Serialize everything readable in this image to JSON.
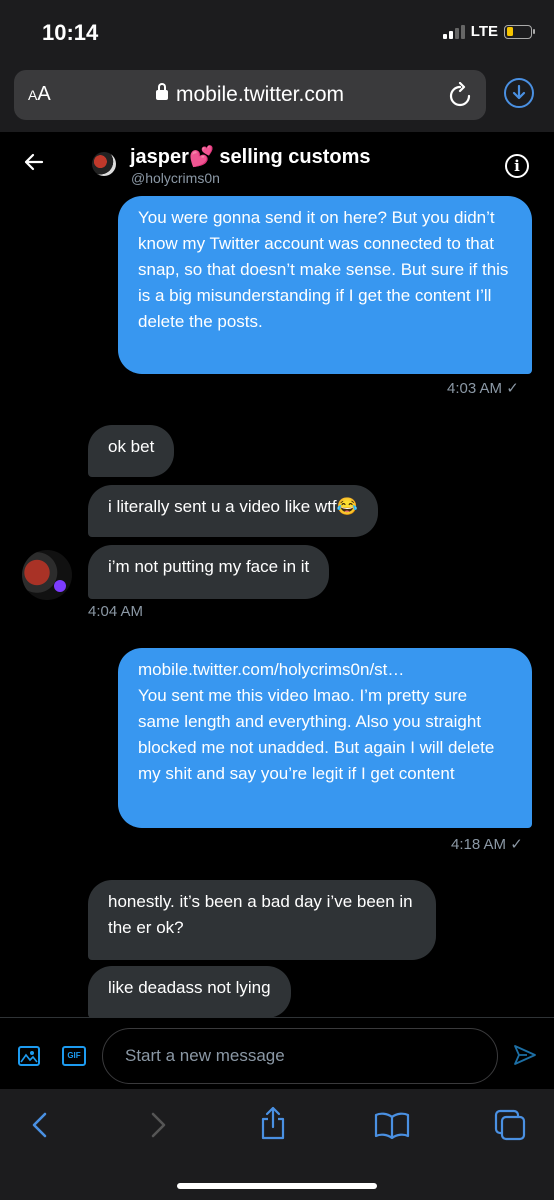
{
  "status_bar": {
    "time": "10:14",
    "network": "LTE"
  },
  "browser": {
    "aa_label": "AA",
    "url": "mobile.twitter.com"
  },
  "header": {
    "name_part1": "jasper",
    "heart": "💕",
    "name_part2": " selling customs",
    "handle": "@holycrims0n"
  },
  "messages": [
    {
      "type": "sent",
      "text": "You were gonna send it on here? But you didn’t know my Twitter account was connected to that snap, so that doesn’t make sense.  But sure if this is a big misunderstanding if I get the content I’ll delete the posts.",
      "time": "4:03 AM ✓"
    },
    {
      "type": "recv",
      "text": "ok bet"
    },
    {
      "type": "recv",
      "text": "i literally sent u a video like wtf😂"
    },
    {
      "type": "recv",
      "text": "i’m not putting my face in it",
      "time": "4:04 AM"
    },
    {
      "type": "sent",
      "link": "mobile.twitter.com/holycrims0n/st…",
      "text": "You sent me this video lmao. I’m pretty sure same length and everything. Also you straight blocked me not unadded. But again I will delete my shit and say you’re legit if I get content",
      "time": "4:18 AM ✓"
    },
    {
      "type": "recv",
      "text": "honestly. it’s been a bad day i’ve been in the er ok?"
    },
    {
      "type": "recv",
      "text": "like deadass not lying"
    }
  ],
  "composer": {
    "placeholder": "Start a new message",
    "gif_label": "GIF"
  },
  "colors": {
    "accent": "#1d9bf0",
    "sent_bubble": "#3897f0",
    "recv_bubble": "#2f3336",
    "background": "#000000"
  }
}
